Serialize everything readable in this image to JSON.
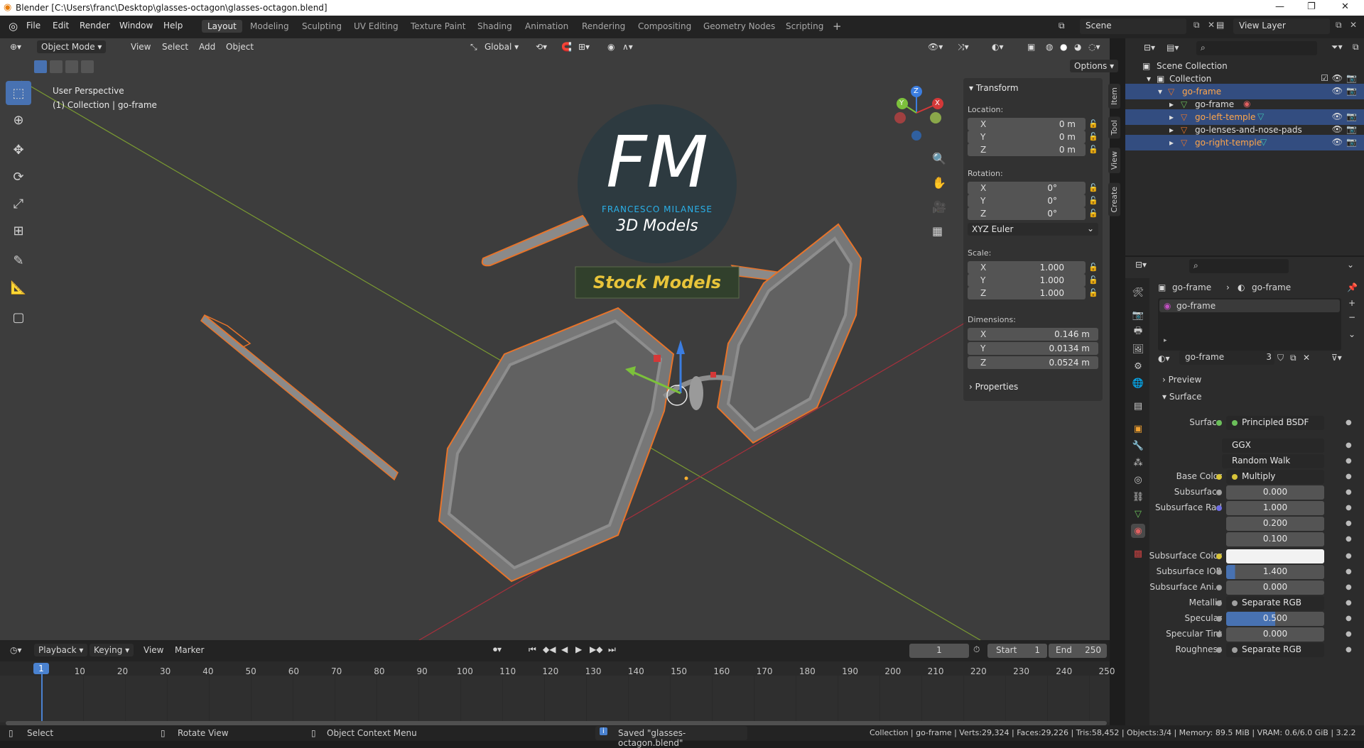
{
  "window": {
    "title": "Blender [C:\\Users\\franc\\Desktop\\glasses-octagon\\glasses-octagon.blend]"
  },
  "menu": [
    "File",
    "Edit",
    "Render",
    "Window",
    "Help"
  ],
  "workspaces": [
    "Layout",
    "Modeling",
    "Sculpting",
    "UV Editing",
    "Texture Paint",
    "Shading",
    "Animation",
    "Rendering",
    "Compositing",
    "Geometry Nodes",
    "Scripting"
  ],
  "scene": {
    "name": "Scene",
    "view_layer": "View Layer"
  },
  "viewport": {
    "mode": "Object Mode",
    "menus": [
      "View",
      "Select",
      "Add",
      "Object"
    ],
    "orientation": "Global",
    "options_label": "Options",
    "overlay_line1": "User Perspective",
    "overlay_line2": "(1) Collection | go-frame",
    "watermark_initials": "FM",
    "watermark_name": "FRANCESCO MILANESE",
    "watermark_sub": "3D Models",
    "watermark_banner": "Stock Models",
    "gizmo_axes": [
      "X",
      "Y",
      "Z"
    ]
  },
  "npanel": {
    "header": "Transform",
    "location_label": "Location:",
    "location": {
      "x": "0 m",
      "y": "0 m",
      "z": "0 m"
    },
    "rotation_label": "Rotation:",
    "rotation": {
      "x": "0°",
      "y": "0°",
      "z": "0°"
    },
    "rotation_mode": "XYZ Euler",
    "scale_label": "Scale:",
    "scale": {
      "x": "1.000",
      "y": "1.000",
      "z": "1.000"
    },
    "dimensions_label": "Dimensions:",
    "dimensions": {
      "x": "0.146 m",
      "y": "0.0134 m",
      "z": "0.0524 m"
    },
    "properties_label": "Properties",
    "axis_labels": {
      "x": "X",
      "y": "Y",
      "z": "Z"
    },
    "tabs": [
      "Item",
      "Tool",
      "View",
      "Create"
    ]
  },
  "outliner": {
    "search_placeholder": "",
    "root": "Scene Collection",
    "collection": "Collection",
    "items": [
      {
        "name": "go-frame",
        "level": 1,
        "selected": true
      },
      {
        "name": "go-frame",
        "level": 2,
        "selected": false
      },
      {
        "name": "go-left-temple",
        "level": 2,
        "selected": true
      },
      {
        "name": "go-lenses-and-nose-pads",
        "level": 2,
        "selected": false
      },
      {
        "name": "go-right-temple",
        "level": 2,
        "selected": true
      }
    ]
  },
  "properties": {
    "breadcrumb_object": "go-frame",
    "breadcrumb_material": "go-frame",
    "slot_name": "go-frame",
    "material_name": "go-frame",
    "material_users": "3",
    "preview_label": "Preview",
    "surface_header": "Surface",
    "rows": [
      {
        "label": "Surface",
        "value": "Principled BSDF",
        "type": "link",
        "dot": "#6bbf5a"
      },
      {
        "label": "",
        "value": "GGX",
        "type": "dropdown"
      },
      {
        "label": "",
        "value": "Random Walk",
        "type": "dropdown"
      },
      {
        "label": "Base Color",
        "value": "Multiply",
        "type": "link",
        "dot": "#d8c43a"
      },
      {
        "label": "Subsurface",
        "value": "0.000",
        "type": "num",
        "dot": "#a0a0a0"
      },
      {
        "label": "Subsurface Rad",
        "value": "1.000",
        "type": "num",
        "dot": "#6d6de0"
      },
      {
        "label": "",
        "value": "0.200",
        "type": "num"
      },
      {
        "label": "",
        "value": "0.100",
        "type": "num"
      },
      {
        "label": "Subsurface Color",
        "value": "",
        "type": "color",
        "dot": "#d8c43a"
      },
      {
        "label": "Subsurface IOR",
        "value": "1.400",
        "type": "num",
        "dot": "#a0a0a0"
      },
      {
        "label": "Subsurface Ani...",
        "value": "0.000",
        "type": "num",
        "dot": "#a0a0a0"
      },
      {
        "label": "Metallic",
        "value": "Separate RGB",
        "type": "link",
        "dot": "#a0a0a0"
      },
      {
        "label": "Specular",
        "value": "0.500",
        "type": "slider",
        "dot": "#a0a0a0"
      },
      {
        "label": "Specular Tint",
        "value": "0.000",
        "type": "num",
        "dot": "#a0a0a0"
      },
      {
        "label": "Roughness",
        "value": "Separate RGB",
        "type": "link",
        "dot": "#a0a0a0"
      }
    ]
  },
  "timeline": {
    "menus": [
      "Playback",
      "Keying",
      "View",
      "Marker"
    ],
    "current_frame": "1",
    "start_label": "Start",
    "start": "1",
    "end_label": "End",
    "end": "250",
    "ruler": [
      "1",
      "10",
      "20",
      "30",
      "40",
      "50",
      "60",
      "70",
      "80",
      "90",
      "100",
      "110",
      "120",
      "130",
      "140",
      "150",
      "160",
      "170",
      "180",
      "190",
      "200",
      "210",
      "220",
      "230",
      "240",
      "250"
    ]
  },
  "statusbar": {
    "select": "Select",
    "rotate": "Rotate View",
    "context": "Object Context Menu",
    "saved": "Saved \"glasses-octagon.blend\"",
    "stats": "Collection | go-frame | Verts:29,324 | Faces:29,226 | Tris:58,452 | Objects:3/4 | Memory: 89.5 MiB | VRAM: 0.6/6.0 GiB | 3.2.2"
  }
}
